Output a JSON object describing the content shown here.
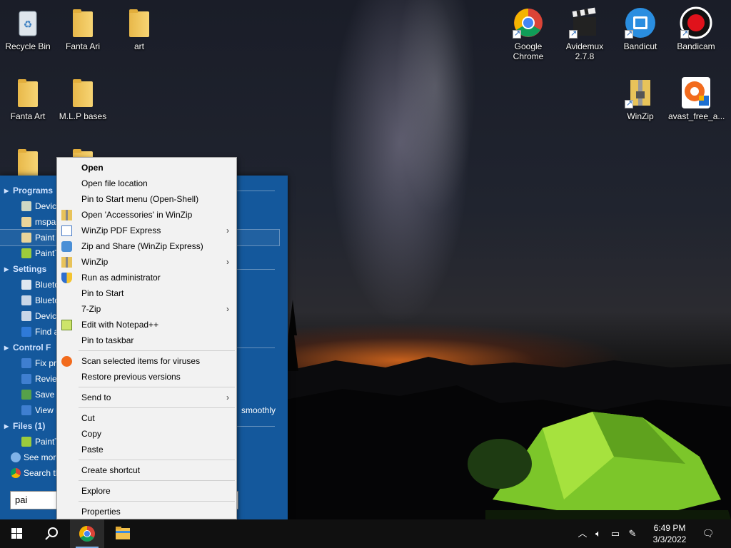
{
  "desktop": {
    "icons": [
      {
        "label": "Recycle Bin"
      },
      {
        "label": "Fanta Ari"
      },
      {
        "label": "art"
      },
      {
        "label": "Fanta Art"
      },
      {
        "label": "M.L.P bases"
      },
      {
        "label": "Google Chrome"
      },
      {
        "label": "Avidemux 2.7.8"
      },
      {
        "label": "Bandicut"
      },
      {
        "label": "Bandicam"
      },
      {
        "label": "WinZip"
      },
      {
        "label": "avast_free_a..."
      }
    ]
  },
  "start_menu": {
    "sections": [
      {
        "header": "Programs",
        "items": [
          "Devic",
          "mspa",
          "Paint",
          "PaintT"
        ]
      },
      {
        "header": "Settings",
        "items": [
          "Blueto",
          "Blueto",
          "Devic",
          "Find a"
        ]
      },
      {
        "header": "Control F",
        "items": [
          "Fix pr",
          "Review",
          "Save b",
          "View r"
        ]
      },
      {
        "header": "Files (1)",
        "items": [
          "PaintT"
        ]
      }
    ],
    "links": [
      "See more",
      "Search th"
    ],
    "search_value": "pai",
    "overflow_text": "smoothly"
  },
  "context_menu": {
    "items": [
      {
        "label": "Open",
        "bold": true
      },
      {
        "label": "Open file location"
      },
      {
        "label": "Pin to Start menu (Open-Shell)"
      },
      {
        "label": "Open 'Accessories' in WinZip",
        "icon": "winzip-icon"
      },
      {
        "label": "WinZip PDF Express",
        "icon": "pdf-icon",
        "submenu": true
      },
      {
        "label": "Zip and Share (WinZip Express)",
        "icon": "zip-share-icon"
      },
      {
        "label": "WinZip",
        "icon": "winzip-icon",
        "submenu": true
      },
      {
        "label": "Run as administrator",
        "icon": "shield-icon"
      },
      {
        "label": "Pin to Start"
      },
      {
        "label": "7-Zip",
        "submenu": true
      },
      {
        "label": "Edit with Notepad++",
        "icon": "notepad-icon"
      },
      {
        "label": "Pin to taskbar"
      },
      {
        "separator": true
      },
      {
        "label": "Scan selected items for viruses",
        "icon": "avast-icon"
      },
      {
        "label": "Restore previous versions"
      },
      {
        "separator": true
      },
      {
        "label": "Send to",
        "submenu": true
      },
      {
        "separator": true
      },
      {
        "label": "Cut"
      },
      {
        "label": "Copy"
      },
      {
        "label": "Paste"
      },
      {
        "separator": true
      },
      {
        "label": "Create shortcut"
      },
      {
        "separator": true
      },
      {
        "label": "Explore"
      },
      {
        "separator": true
      },
      {
        "label": "Properties"
      }
    ],
    "submenu_arrow": "›"
  },
  "taskbar": {
    "clock_time": "6:49 PM",
    "clock_date": "3/3/2022",
    "tray_icons": [
      "chevron-up-icon",
      "volume-icon",
      "network-icon",
      "pen-icon",
      "notification-icon"
    ]
  },
  "colors": {
    "start_menu_bg": "#14589c",
    "context_menu_bg": "#f2f2f2",
    "taskbar_bg": "#101010",
    "accent": "#7fb2e8"
  }
}
